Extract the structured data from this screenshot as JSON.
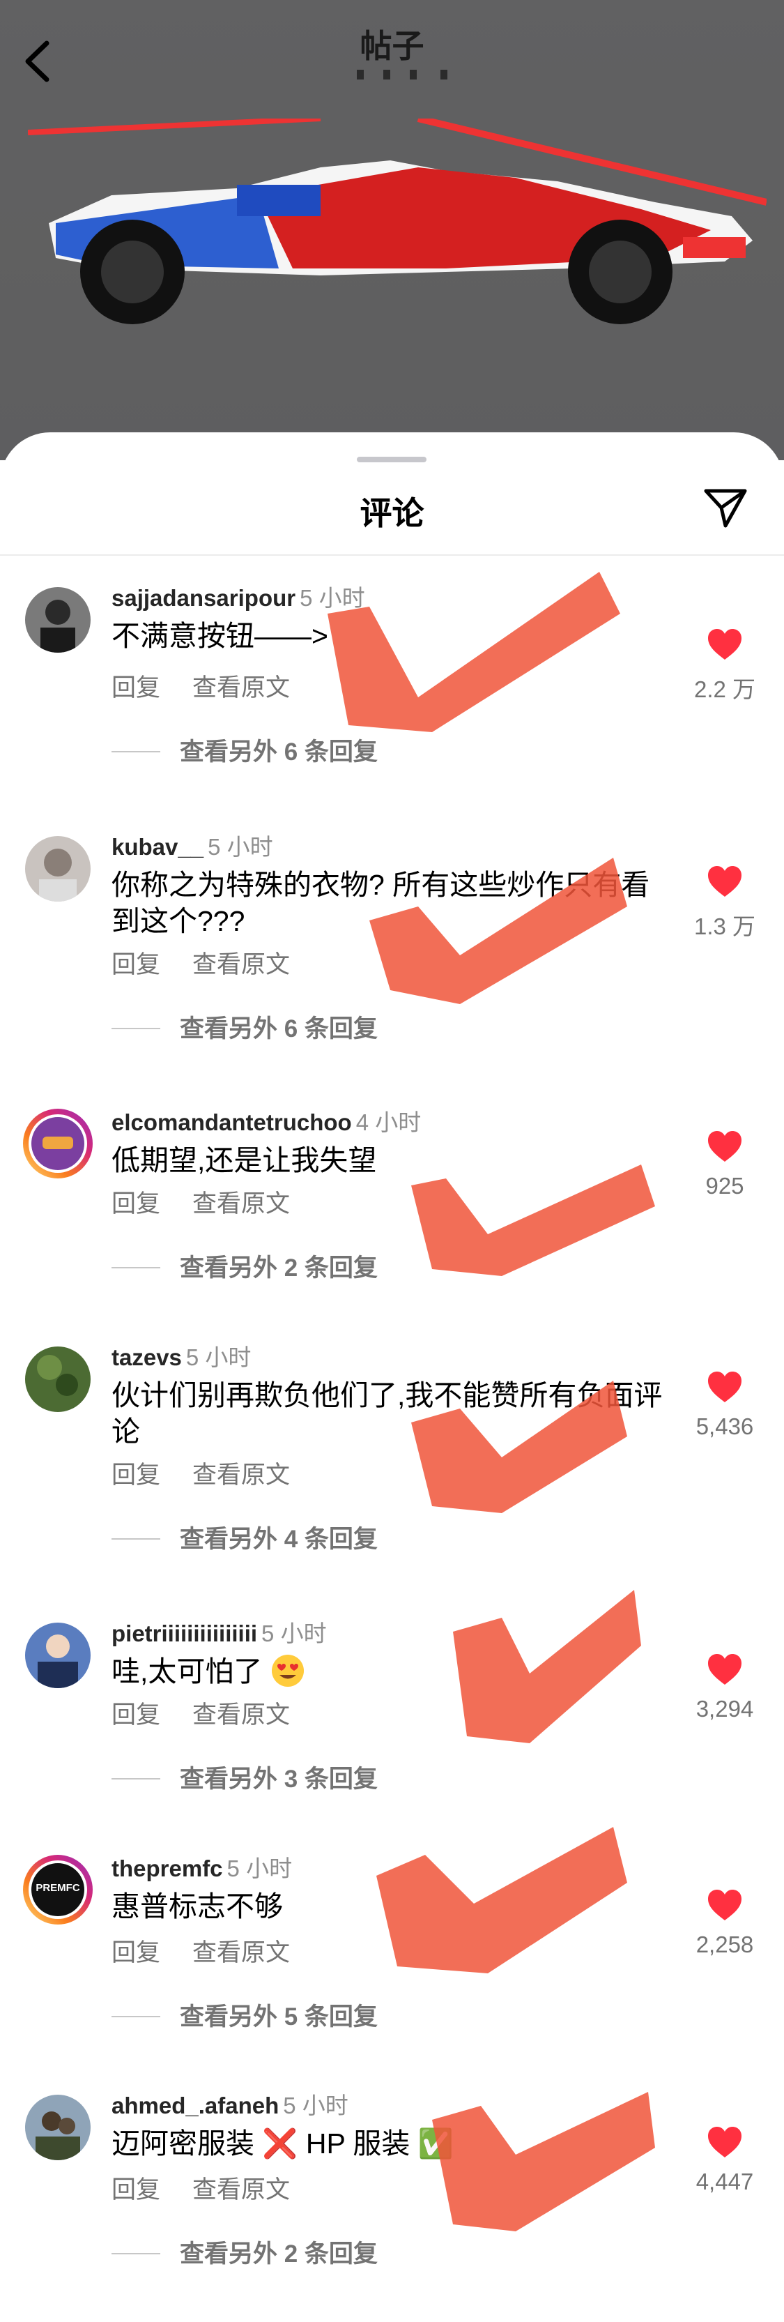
{
  "header": {
    "title": "帖子"
  },
  "sheet": {
    "title": "评论"
  },
  "actions": {
    "reply_label": "回复",
    "translate_label": "查看原文"
  },
  "comments": [
    {
      "username": "sajjadansaripour",
      "time": "5 小时",
      "text": "不满意按钮——>",
      "likes": "2.2 万",
      "replies_label": "查看另外 6 条回复",
      "avatar_color": "#6b6b6b"
    },
    {
      "username": "kubav__",
      "time": "5 小时",
      "text": "你称之为特殊的衣物? 所有这些炒作只有看到这个???",
      "likes": "1.3 万",
      "replies_label": "查看另外 6 条回复",
      "avatar_color": "#a89a90"
    },
    {
      "username": "elcomandantetruchoo",
      "time": "4 小时",
      "text": "低期望,还是让我失望",
      "likes": "925",
      "replies_label": "查看另外 2 条回复",
      "avatar_color": "#7b3fa0"
    },
    {
      "username": "tazevs",
      "time": "5 小时",
      "text": "伙计们别再欺负他们了,我不能赞所有负面评论",
      "likes": "5,436",
      "replies_label": "查看另外 4 条回复",
      "avatar_color": "#3f5a2a"
    },
    {
      "username": "pietriiiiiiiiiiiiiii",
      "time": "5 小时",
      "text": "哇,太可怕了",
      "likes": "3,294",
      "replies_label": "查看另外 3 条回复",
      "avatar_color": "#3a4f7a"
    },
    {
      "username": "theprem​fc",
      "time": "5 小时",
      "text": "惠普标志不够",
      "likes": "2,258",
      "replies_label": "查看另外 5 条回复",
      "avatar_color": "#111111",
      "avatar_text": "PREMFC"
    },
    {
      "username": "ahmed_.afaneh",
      "time": "5 小时",
      "text": "迈阿密服装 ❌ HP 服装 ✅",
      "likes": "4,447",
      "replies_label": "查看另外 2 条回复",
      "avatar_color": "#6f7c5a"
    }
  ],
  "colors": {
    "like_red": "#ff3040",
    "scribble": "#f0553a"
  }
}
